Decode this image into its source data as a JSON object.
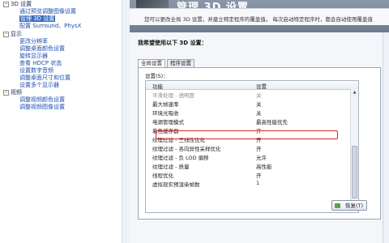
{
  "sidebar": {
    "items": [
      {
        "label": "3D 设置",
        "kind": "category",
        "expanded": true
      },
      {
        "label": "通过预览调整图像设置",
        "kind": "link"
      },
      {
        "label": "管理 3D 设置",
        "kind": "link",
        "selected": true
      },
      {
        "label": "配置 Surround、PhysX",
        "kind": "link"
      },
      {
        "label": "显示",
        "kind": "category",
        "expanded": true
      },
      {
        "label": "更改分辨率",
        "kind": "link"
      },
      {
        "label": "调整桌面颜色设置",
        "kind": "link"
      },
      {
        "label": "旋转显示器",
        "kind": "link"
      },
      {
        "label": "查看 HDCP 状态",
        "kind": "link"
      },
      {
        "label": "设置数字音频",
        "kind": "link"
      },
      {
        "label": "调整桌面尺寸和位置",
        "kind": "link"
      },
      {
        "label": "设置多个显示器",
        "kind": "link"
      },
      {
        "label": "视频",
        "kind": "category",
        "expanded": true
      },
      {
        "label": "调整视频颜色设置",
        "kind": "link"
      },
      {
        "label": "调整视频图像设置",
        "kind": "link"
      }
    ]
  },
  "header": {
    "title": "管理 3D 设置",
    "description": "您可以更改全局 3D 设置，并建立特定程序的覆盖值。 每次启动特定程序时，都会自动使用覆盖值"
  },
  "content": {
    "section_label": "我希望使用以下 3D 设置：",
    "tabs": [
      {
        "label": "全局设置",
        "active": true
      },
      {
        "label": "程序设置",
        "active": false
      }
    ],
    "settings_label": "设置(S)：",
    "columns": {
      "feature": "功能",
      "setting": "设置"
    },
    "rows": [
      {
        "feature": "平滑处理 - 透明度",
        "value": "关",
        "dim": true
      },
      {
        "feature": "最大帧速率",
        "value": "关"
      },
      {
        "feature": "环境光吸收",
        "value": "关"
      },
      {
        "feature": "电源管理模式",
        "value": "最高性能优先",
        "highlighted": true
      },
      {
        "feature": "着色缓存器",
        "value": "开"
      },
      {
        "feature": "纹理过滤 - 三线性优化",
        "value": "开"
      },
      {
        "feature": "纹理过滤 - 各向异性采样优化",
        "value": "开"
      },
      {
        "feature": "纹理过滤 - 负 LOD 偏移",
        "value": "允许"
      },
      {
        "feature": "纹理过滤 - 质量",
        "value": "高性能"
      },
      {
        "feature": "线程优化",
        "value": "开"
      },
      {
        "feature": "虚拟现实预渲染帧数",
        "value": "1"
      }
    ],
    "restore_button": "恢复(T)"
  },
  "colors": {
    "highlight_border": "#e02020",
    "header_bg": "#7c8a9b",
    "selected_bg": "#3a6cc0"
  }
}
